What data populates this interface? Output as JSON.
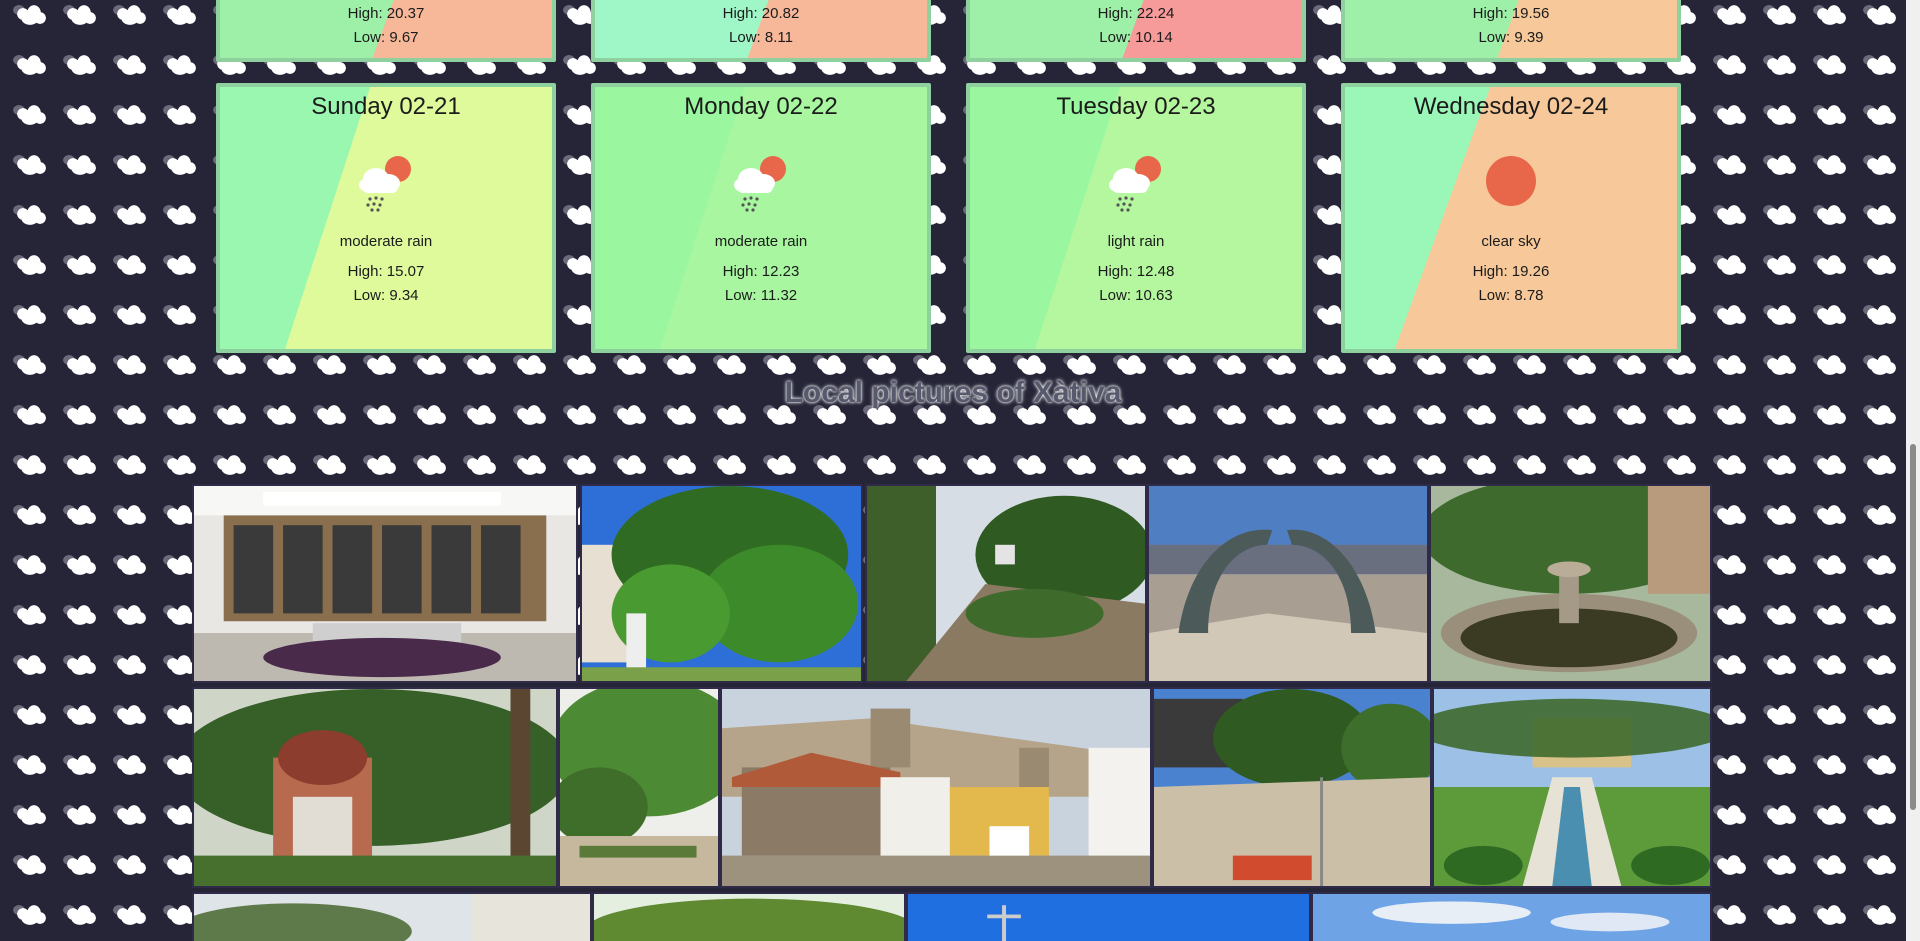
{
  "forecast_top": [
    {
      "high": "High: 20.37",
      "low": "Low: 9.67"
    },
    {
      "high": "High: 20.82",
      "low": "Low: 8.11"
    },
    {
      "high": "High: 22.24",
      "low": "Low: 10.14"
    },
    {
      "high": "High: 19.56",
      "low": "Low: 9.39"
    }
  ],
  "forecast": [
    {
      "day": "Sunday 02-21",
      "icon": "rain-cloud-sun-icon",
      "desc": "moderate rain",
      "high": "High: 15.07",
      "low": "Low: 9.34"
    },
    {
      "day": "Monday 02-22",
      "icon": "rain-cloud-sun-icon",
      "desc": "moderate rain",
      "high": "High: 12.23",
      "low": "Low: 11.32"
    },
    {
      "day": "Tuesday 02-23",
      "icon": "rain-cloud-sun-icon",
      "desc": "light rain",
      "high": "High: 12.48",
      "low": "Low: 10.63"
    },
    {
      "day": "Wednesday 02-24",
      "icon": "sun-icon",
      "desc": "clear sky",
      "high": "High: 19.26",
      "low": "Low: 8.78"
    }
  ],
  "gallery": {
    "title": "Local pictures of Xàtiva"
  },
  "colors": {
    "background": "#262538",
    "card_border": "#8fd19e",
    "sun": "#e8674a"
  }
}
